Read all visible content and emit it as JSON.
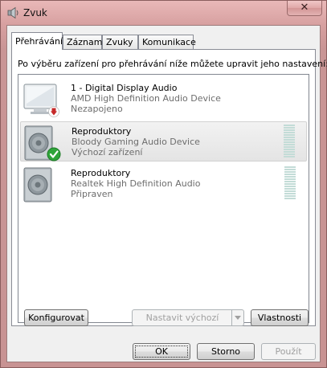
{
  "window": {
    "title": "Zvuk",
    "close_glyph": "✕"
  },
  "tabs": [
    {
      "label": "Přehrávání",
      "active": true
    },
    {
      "label": "Záznam",
      "active": false
    },
    {
      "label": "Zvuky",
      "active": false
    },
    {
      "label": "Komunikace",
      "active": false
    }
  ],
  "playback": {
    "instruction": "Po výběru zařízení pro přehrávání níže můžete upravit jeho nastavení:",
    "devices": [
      {
        "name": "1 - Digital Display Audio",
        "driver": "AMD High Definition Audio Device",
        "status": "Nezapojeno",
        "icon": "monitor-icon",
        "badge": "unplugged-badge-icon",
        "selected": false
      },
      {
        "name": "Reproduktory",
        "driver": "Bloody Gaming Audio Device",
        "status": "Výchozí zařízení",
        "icon": "speaker-icon",
        "badge": "default-check-badge-icon",
        "selected": true
      },
      {
        "name": "Reproduktory",
        "driver": "Realtek High Definition Audio",
        "status": "Připraven",
        "icon": "speaker-icon",
        "badge": null,
        "selected": false
      }
    ],
    "buttons": {
      "configure": "Konfigurovat",
      "set_default": "Nastavit výchozí",
      "properties": "Vlastnosti"
    }
  },
  "dialog_buttons": {
    "ok": "OK",
    "cancel": "Storno",
    "apply": "Použít"
  },
  "colors": {
    "title_bar": "#d7a0a0",
    "client_bg": "#f0f0f0",
    "meter": "#c3dcd7",
    "check_green": "#2fa53a",
    "unplug_red": "#c62a2a"
  }
}
